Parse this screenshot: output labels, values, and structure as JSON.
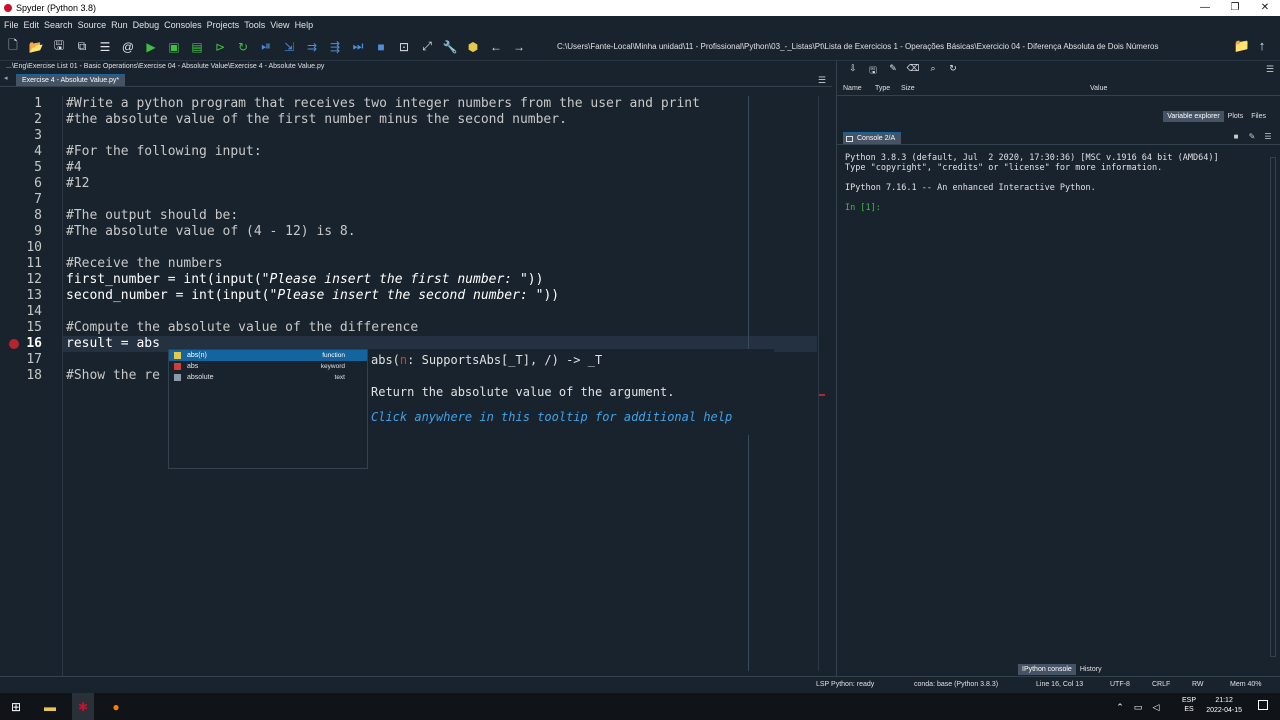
{
  "window": {
    "title": "Spyder (Python 3.8)",
    "controls": [
      "—",
      "❐",
      "✕"
    ]
  },
  "menu": [
    "File",
    "Edit",
    "Search",
    "Source",
    "Run",
    "Debug",
    "Consoles",
    "Projects",
    "Tools",
    "View",
    "Help"
  ],
  "toolbar": {
    "path": "C:\\Users\\Fante-Local\\Minha unidad\\11 - Profissional\\Python\\03_-_Listas\\Pt\\Lista de Exercicios 1 - Operações Básicas\\Exercicio 04 - Diferença Absoluta de Dois Números"
  },
  "editor": {
    "breadcrumb": "...\\Eng\\Exercise List 01 - Basic Operations\\Exercise 04 - Absolute Value\\Exercise 4 - Absolute Value.py",
    "tab_label": "Exercise 4 - Absolute Value.py*",
    "line_numbers": [
      "1",
      "2",
      "3",
      "4",
      "5",
      "6",
      "7",
      "8",
      "9",
      "10",
      "11",
      "12",
      "13",
      "14",
      "15",
      "16",
      "17",
      "18"
    ],
    "lines": {
      "l1": "#Write a python program that receives two integer numbers from the user and print",
      "l2": "#the absolute value of the first number minus the second number.",
      "l4": "#For the following input:",
      "l5": "#4",
      "l6": "#12",
      "l8": "#The output should be:",
      "l9": "#The absolute value of (4 - 12) is 8.",
      "l11": "#Receive the numbers",
      "l12a": "first_number = int(input(",
      "l12b": "\"Please insert the first number: \"",
      "l12c": "))",
      "l13a": "second_number = int(input(",
      "l13b": "\"Please insert the second number: \"",
      "l13c": "))",
      "l15": "#Compute the absolute value of the difference",
      "l16": "result = abs",
      "l18": "#Show the re"
    }
  },
  "completion": {
    "items": [
      {
        "label": "abs(n)",
        "kind": "function"
      },
      {
        "label": "abs",
        "kind": "keyword"
      },
      {
        "label": "absolute",
        "kind": "text"
      }
    ]
  },
  "tooltip": {
    "sig_a": "abs(",
    "sig_param": "n",
    "sig_b": ": SupportsAbs[_T], /) -> _T",
    "doc": "Return the absolute value of the argument.",
    "help": "Click anywhere in this tooltip for additional help"
  },
  "variable_explorer": {
    "columns": [
      "Name",
      "Type",
      "Size",
      "Value"
    ],
    "tabs": [
      "Variable explorer",
      "Plots",
      "Files"
    ]
  },
  "console": {
    "tab_label": "Console 2/A",
    "text": "Python 3.8.3 (default, Jul  2 2020, 17:30:36) [MSC v.1916 64 bit (AMD64)]\nType \"copyright\", \"credits\" or \"license\" for more information.\n\nIPython 7.16.1 -- An enhanced Interactive Python.",
    "prompt": "In [1]:",
    "bottom_tabs": [
      "IPython console",
      "History"
    ]
  },
  "status": {
    "lsp": "LSP Python: ready",
    "conda": "conda: base (Python 3.8.3)",
    "position": "Line 16, Col 13",
    "encoding": "UTF-8",
    "eol": "CRLF",
    "rw": "RW",
    "mem": "Mem 40%"
  },
  "taskbar": {
    "lang_1": "ESP",
    "lang_2": "ES",
    "time": "21:12",
    "date": "2022-04-15"
  }
}
